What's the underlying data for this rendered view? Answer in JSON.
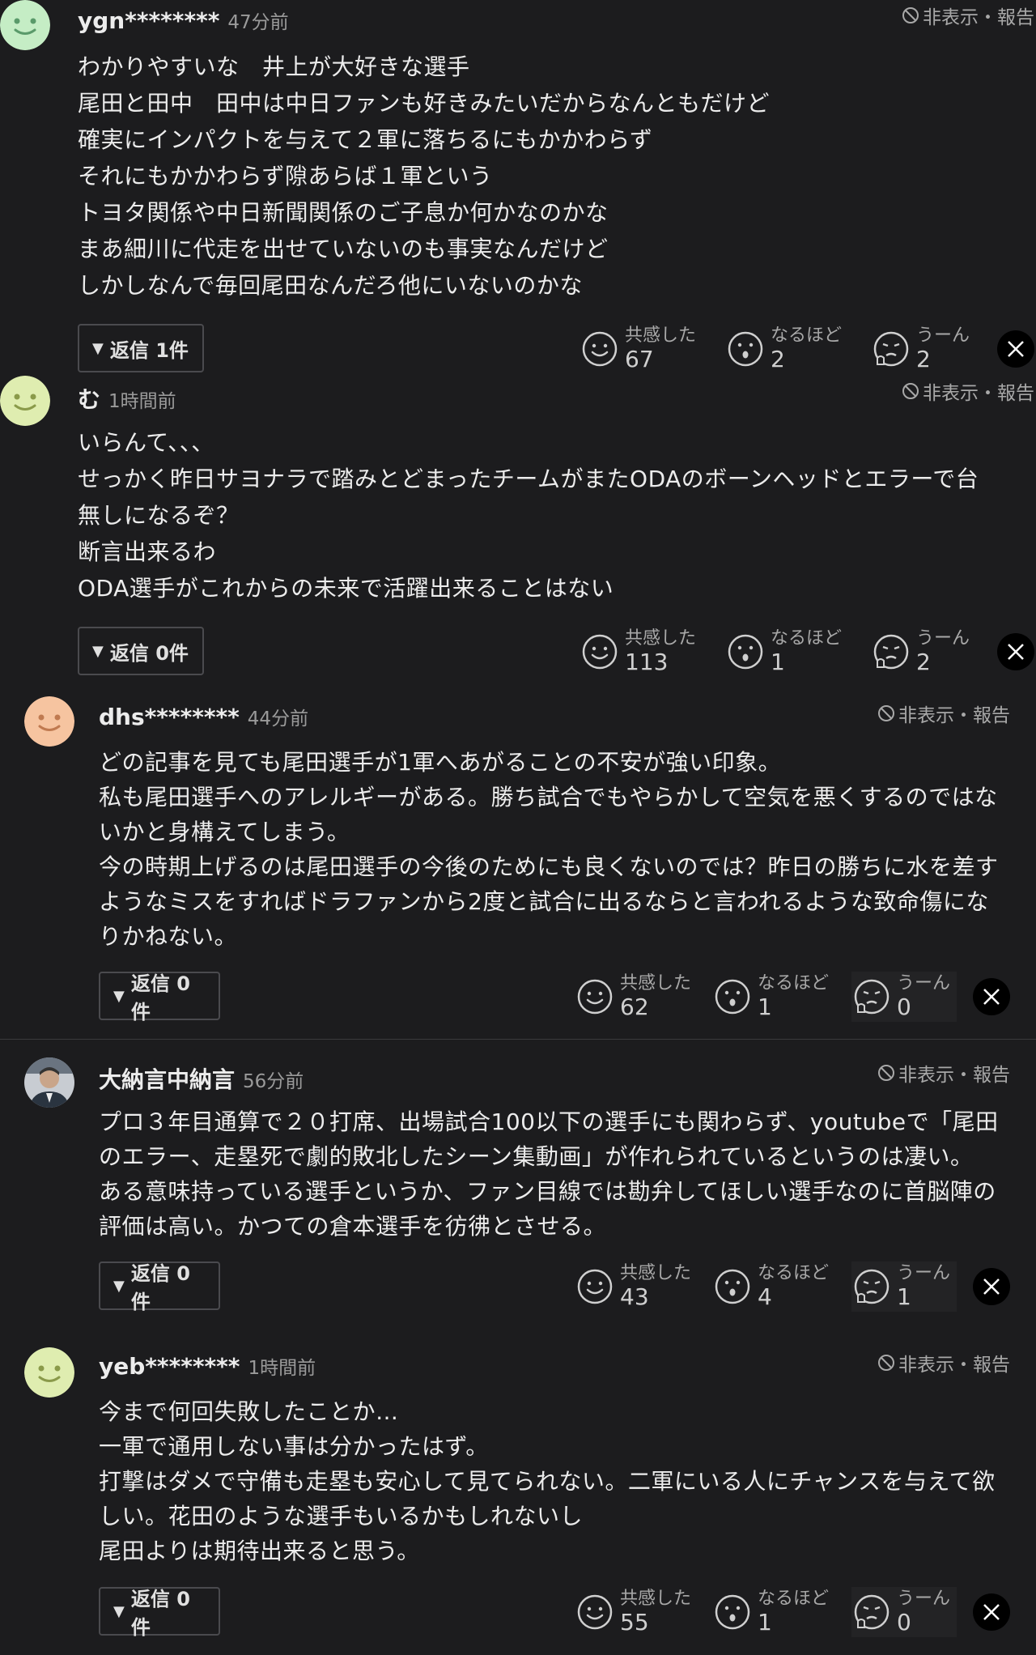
{
  "hide_report_label": "非表示・報告",
  "reaction_labels": {
    "empathy": "共感した",
    "naruhodo": "なるほど",
    "uun": "うーん"
  },
  "icons": {
    "hide": "prohibit-icon",
    "share": "x-logo-icon"
  },
  "comments": [
    {
      "username": "ygn********",
      "time": "47分前",
      "avatar": "green-smiley",
      "lines": [
        "わかりやすいな　井上が大好きな選手",
        "尾田と田中　田中は中日ファンも好きみたいだからなんともだけど",
        "確実にインパクトを与えて２軍に落ちるにもかかわらず",
        "それにもかかわらず隙あらば１軍という",
        "トヨタ関係や中日新聞関係のご子息か何かなのかな",
        "まあ細川に代走を出せていないのも事実なんだけど",
        "しかしなんで毎回尾田なんだろ他にいないのかな"
      ],
      "reply_label": "返信 1件",
      "counts": {
        "empathy": "67",
        "naruhodo": "2",
        "uun": "2"
      }
    },
    {
      "username": "む",
      "time": "1時間前",
      "avatar": "green-smiley",
      "lines": [
        "いらんて、、、",
        "せっかく昨日サヨナラで踏みとどまったチームがまたODAのボーンヘッドとエラーで台",
        "無しになるぞ？",
        "断言出来るわ",
        "ODA選手がこれからの未来で活躍出来ることはない"
      ],
      "reply_label": "返信 0件",
      "counts": {
        "empathy": "113",
        "naruhodo": "1",
        "uun": "2"
      }
    },
    {
      "username": "dhs********",
      "time": "44分前",
      "avatar": "orange-smiley",
      "lines": [
        "どの記事を見ても尾田選手が1軍へあがることの不安が強い印象。",
        "私も尾田選手へのアレルギーがある。勝ち試合でもやらかして空気を悪くするのではな",
        "いかと身構えてしまう。",
        "今の時期上げるのは尾田選手の今後のためにも良くないのでは？昨日の勝ちに水を差す",
        "ようなミスをすればドラファンから2度と試合に出るならと言われるような致命傷にな",
        "りかねない。"
      ],
      "reply_label": "返信 0件",
      "counts": {
        "empathy": "62",
        "naruhodo": "1",
        "uun": "0"
      }
    },
    {
      "username": "大納言中納言",
      "time": "56分前",
      "avatar": "photo-man",
      "lines": [
        "プロ３年目通算で２０打席、出場試合100以下の選手にも関わらず、youtubeで「尾田",
        "のエラー、走塁死で劇的敗北したシーン集動画」が作れられているというのは凄い。",
        "ある意味持っている選手というか、ファン目線では勘弁してほしい選手なのに首脳陣の",
        "評価は高い。かつての倉本選手を彷彿とさせる。"
      ],
      "reply_label": "返信 0件",
      "counts": {
        "empathy": "43",
        "naruhodo": "4",
        "uun": "1"
      }
    },
    {
      "username": "yeb********",
      "time": "1時間前",
      "avatar": "yellow-green-smiley",
      "lines": [
        "今まで何回失敗したことか…",
        "一軍で通用しない事は分かったはず。",
        "打撃はダメで守備も走塁も安心して見てられない。二軍にいる人にチャンスを与えて欲",
        "しい。花田のような選手もいるかもしれないし",
        "尾田よりは期待出来ると思う。"
      ],
      "reply_label": "返信 0件",
      "counts": {
        "empathy": "55",
        "naruhodo": "1",
        "uun": "0"
      }
    }
  ]
}
